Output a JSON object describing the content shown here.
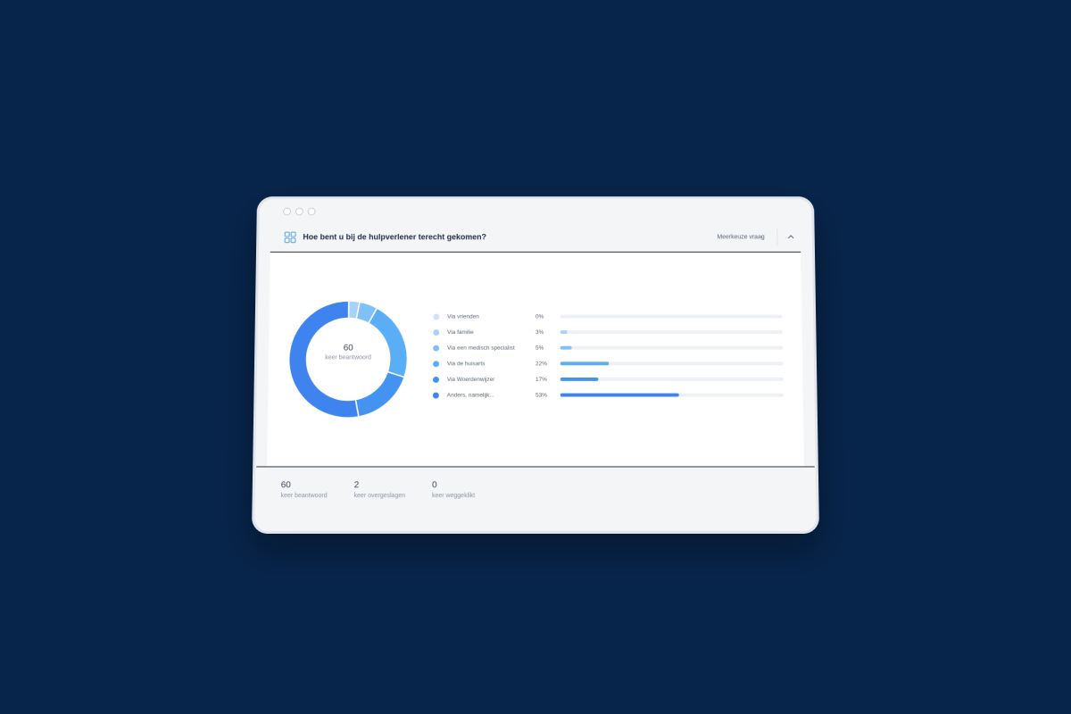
{
  "header": {
    "title": "Hoe bent u bij de hulpverlener terecht gekomen?",
    "question_type": "Meerkeuze vraag",
    "icon": "grid-icon",
    "collapse_icon": "chevron-up-icon"
  },
  "summary": {
    "count": "60",
    "label": "keer beantwoord"
  },
  "chart_data": {
    "type": "pie",
    "categories": [
      "Via vrienden",
      "Via familie",
      "Via een medisch specialist",
      "Via de huisarts",
      "Via Woerdenwijzer",
      "Anders, namelijk..."
    ],
    "values": [
      0,
      3,
      5,
      22,
      17,
      53
    ],
    "percent_labels": [
      "0%",
      "3%",
      "5%",
      "22%",
      "17%",
      "53%"
    ],
    "colors": [
      "#cfe4fb",
      "#a9d2f8",
      "#7fc0f6",
      "#5aaef5",
      "#4593f1",
      "#3f84ee"
    ]
  },
  "stats": [
    {
      "value": "60",
      "label": "keer beantwoord"
    },
    {
      "value": "2",
      "label": "keer overgeslagen"
    },
    {
      "value": "0",
      "label": "keer weggeklikt"
    }
  ]
}
